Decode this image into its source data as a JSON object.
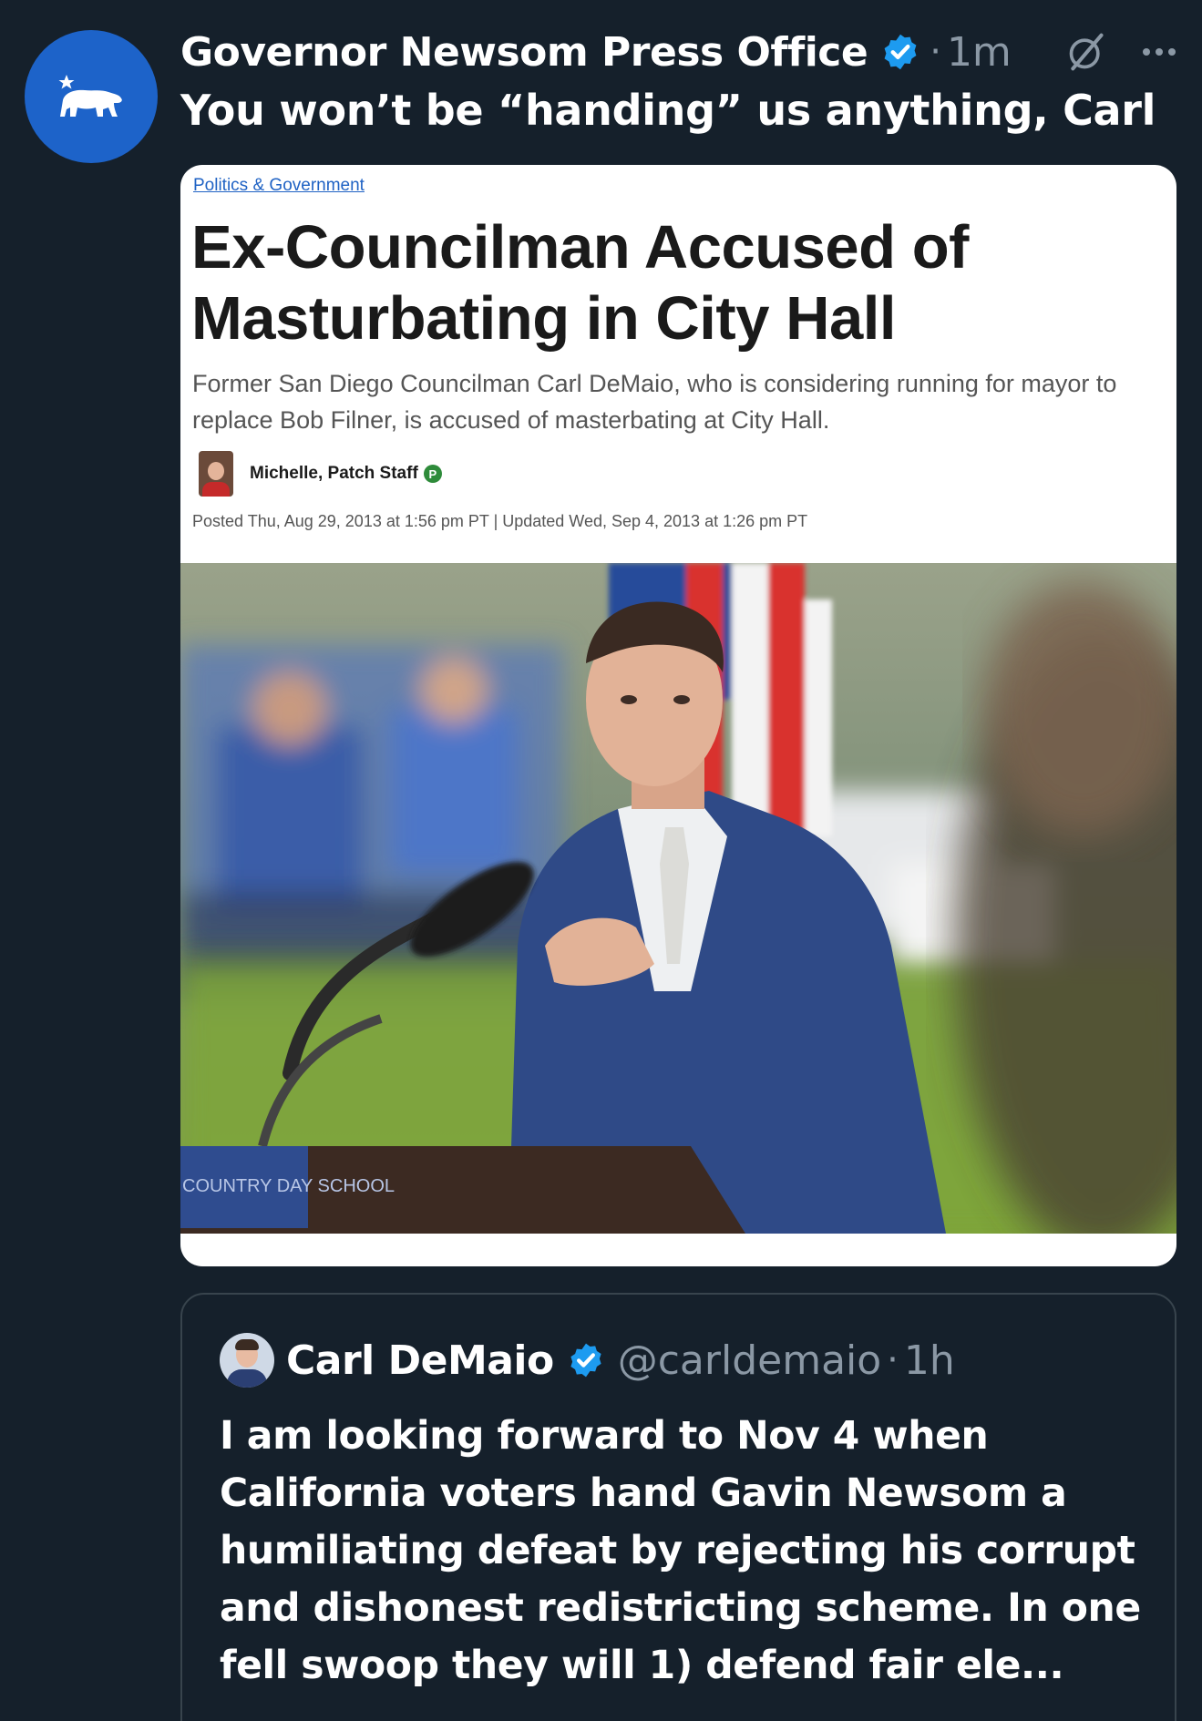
{
  "post": {
    "author": {
      "display_name": "Governor Newsom Press Office",
      "verified": true,
      "avatar_icon": "california-bear-star-icon",
      "avatar_color": "#1d63c9"
    },
    "time_separator": "·",
    "timestamp": "1m",
    "text": "You won’t be “handing” us anything, Carl",
    "grok_icon": "grok-icon",
    "more_icon": "more-options-icon",
    "accent_color": "#1d9bf0"
  },
  "media": {
    "article": {
      "category": "Politics & Government",
      "title": "Ex-Councilman Accused of Masturbating in City Hall",
      "summary": "Former San Diego Councilman Carl DeMaio, who is considering running for mayor to replace Bob Filner, is accused of masterbating at City Hall.",
      "author": "Michelle, Patch Staff",
      "author_badge": "P",
      "dates": "Posted Thu, Aug 29, 2013 at 1:56 pm PT  |  Updated Wed, Sep 4, 2013 at 1:26 pm PT"
    },
    "photo": {
      "podium_sign": "COUNTRY DAY SCHOOL"
    }
  },
  "quoted_post": {
    "author": {
      "display_name": "Carl DeMaio",
      "handle": "@carldemaio",
      "verified": true
    },
    "time_separator": "·",
    "timestamp": "1h",
    "text": "I am looking forward to Nov 4 when California voters hand Gavin Newsom a humiliating defeat by rejecting his corrupt and dishonest redistricting scheme.  In one fell swoop they will 1) defend fair ele..."
  }
}
